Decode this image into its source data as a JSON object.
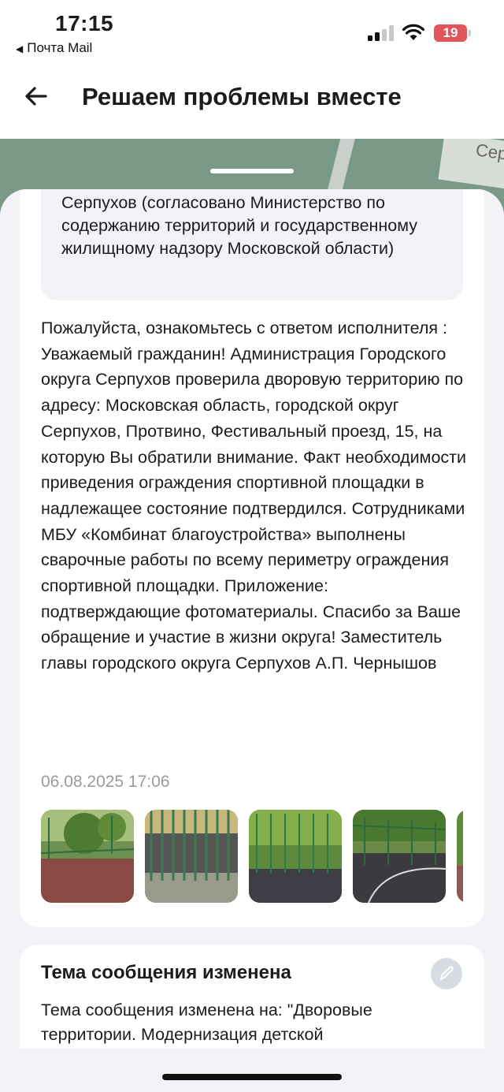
{
  "status_bar": {
    "time": "17:15",
    "back_app": "Почта Mail",
    "battery": "19",
    "icons": [
      "signal-icon",
      "wifi-icon",
      "battery-icon"
    ]
  },
  "header": {
    "title": "Решаем проблемы вместе",
    "back_icon": "arrow-left-icon"
  },
  "map": {
    "street_fragment": "Сер"
  },
  "response_card": {
    "quote_text": "Серпухов (согласовано Министерство по содержанию территорий и государственному жилищному надзору Московской области)",
    "answer_text": "Пожалуйста, ознакомьтесь с ответом исполнителя : Уважаемый гражданин! Администрация Городского округа Серпухов проверила дворовую территорию по адресу: Московская область, городской округ Серпухов, Протвино, Фестивальный проезд, 15, на которую Вы обратили внимание. Факт необходимости приведения ограждения спортивной площадки в надлежащее состояние подтвердился. Сотрудниками МБУ «Комбинат благоустройства» выполнены сварочные работы по всему периметру ограждения спортивной площадки. Приложение: подтверждающие фотоматериалы. Спасибо за Ваше обращение и участие в жизни округа! Заместитель главы городского округа Серпухов А.П. Чернышов",
    "date": "06.08.2025 17:06",
    "photo_count": 5
  },
  "topic_card": {
    "title": "Тема сообщения изменена",
    "text": "Тема сообщения изменена на: \"Дворовые территории. Модернизация детской",
    "edit_icon": "pencil-icon"
  },
  "colors": {
    "accent_red": "#e0545a",
    "sheet_bg": "#f2f2f7",
    "muted": "#9a9aa0",
    "map_green": "#7a9a87"
  }
}
